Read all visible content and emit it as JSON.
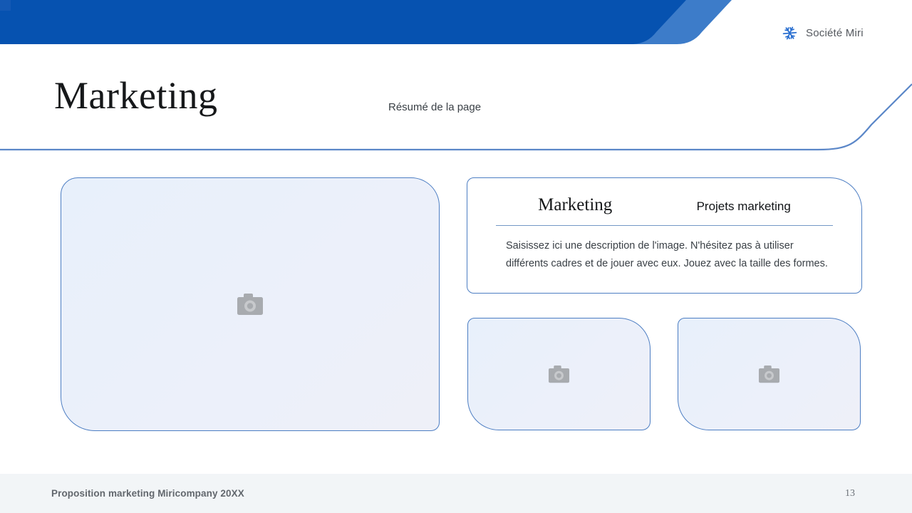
{
  "brand": {
    "name": "Société Miri",
    "icon": "snowflake-icon"
  },
  "title": "Marketing",
  "subtitle": "Résumé de la page",
  "card": {
    "heading_serif": "Marketing",
    "heading_sans": "Projets marketing",
    "body": "Saisissez ici une description de l'image. N'hésitez pas à utiliser différents cadres et de jouer avec eux. Jouez avec la taille des formes."
  },
  "placeholders": [
    {
      "name": "large-image-placeholder",
      "icon": "camera-icon"
    },
    {
      "name": "small-image-placeholder-1",
      "icon": "camera-icon"
    },
    {
      "name": "small-image-placeholder-2",
      "icon": "camera-icon"
    }
  ],
  "footer": {
    "left": "Proposition marketing Miricompany 20XX",
    "page_number": "13"
  },
  "colors": {
    "header_dark_blue": "#0652b0",
    "header_light_blue": "#3d7cc9",
    "corner_square_blue": "#1459b4",
    "divider_line_blue": "#5b87c8",
    "placeholder_border_blue": "#4d7ec3",
    "placeholder_fill": "#e9f0fb",
    "card_rule_blue": "#7397c6",
    "footer_background": "#f2f5f7",
    "camera_icon_gray": "#a8abaf"
  }
}
